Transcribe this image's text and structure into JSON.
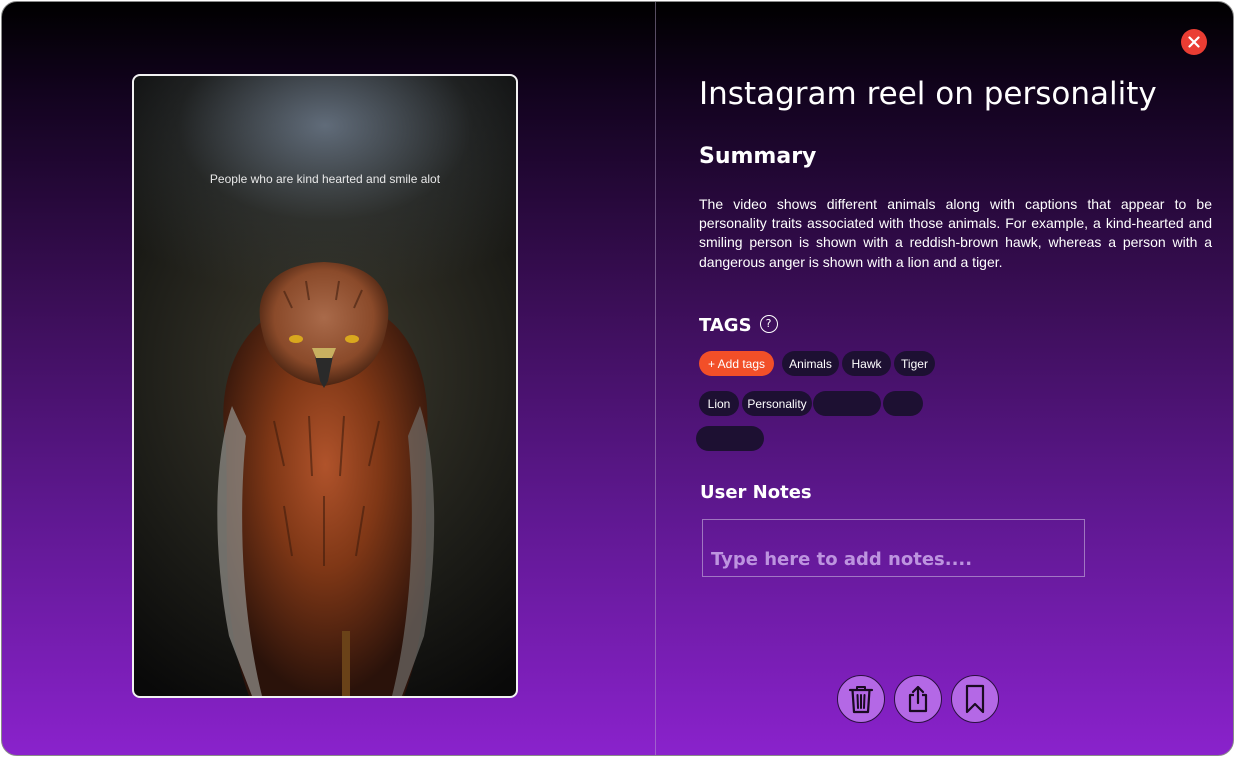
{
  "media": {
    "caption": "People who are kind hearted and smile alot"
  },
  "detail": {
    "title": "Instagram reel on personality",
    "summary_heading": "Summary",
    "summary_text": "The video shows different animals along with captions that appear to be personality traits associated with those animals. For example, a kind-hearted and smiling person is shown with a reddish-brown hawk, whereas a person with a dangerous anger is shown with a lion and a tiger.",
    "tags_heading": "TAGS",
    "help_icon": "?",
    "add_tag_label": "+ Add tags",
    "tags": [
      "Animals",
      "Hawk",
      "Tiger",
      "Lion",
      "Personality",
      "",
      "",
      ""
    ],
    "notes_heading": "User Notes",
    "notes_placeholder": "Type here to add notes....",
    "notes_value": ""
  },
  "actions": {
    "close_icon": "close-icon",
    "buttons": [
      "trash-icon",
      "share-icon",
      "bookmark-icon"
    ]
  },
  "colors": {
    "accent_orange": "#f24f28",
    "close_red": "#ea3d33",
    "button_purple": "#b468e6",
    "chip_dark": "#1d1032"
  }
}
